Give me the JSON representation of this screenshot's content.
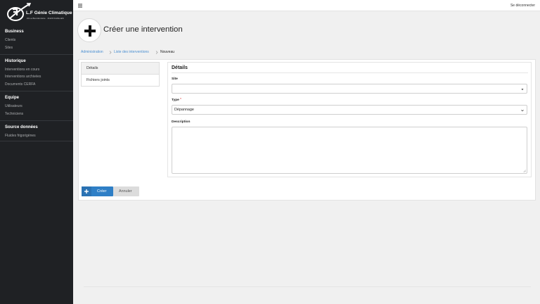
{
  "brand": {
    "name": "L.F Génie Climatique",
    "address": "ZA La Bourdonnière · 41120 CHAILLES"
  },
  "sidebar": {
    "sections": [
      {
        "title": "Business",
        "items": [
          "Clients",
          "Sites"
        ]
      },
      {
        "title": "Historique",
        "items": [
          "Interventions en cours",
          "Interventions archivées",
          "Documents CERFA"
        ]
      },
      {
        "title": "Equipe",
        "items": [
          "Utilisateurs",
          "Techniciens"
        ]
      },
      {
        "title": "Source données",
        "items": [
          "Fluides frigorigènes"
        ]
      }
    ]
  },
  "topbar": {
    "menu_icon": "hamburger-icon",
    "logout_label": "Se déconnecter"
  },
  "page": {
    "title": "Créer une intervention",
    "header_icon": "plus-icon"
  },
  "breadcrumb": {
    "items": [
      "Administration",
      "Liste des interventions",
      "Nouveau"
    ]
  },
  "tabs": [
    "Détails",
    "Fichiers joints"
  ],
  "form": {
    "title": "Détails",
    "site_label": "Site",
    "site_value": "",
    "type_label": "Type",
    "type_required_mark": "*",
    "type_value": "Dépannage",
    "description_label": "Description",
    "description_value": ""
  },
  "actions": {
    "create_label": "Créer",
    "cancel_label": "Annuler"
  },
  "colors": {
    "sidebar_bg": "#1f2124",
    "accent": "#2f7fc6",
    "link": "#4a8fd1",
    "required": "#e03c3c"
  }
}
